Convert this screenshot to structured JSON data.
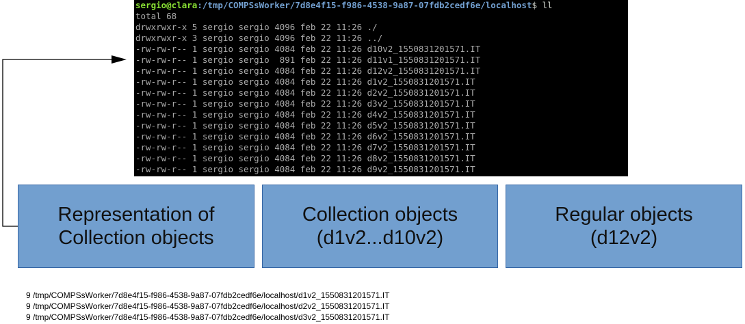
{
  "terminal": {
    "prompt": {
      "user_host": "sergio@clara",
      "path": ":/tmp/COMPSsWorker/7d8e4f15-f986-4538-9a87-07fdb2cedf6e/localhost",
      "command": "$ ll"
    },
    "lines": [
      "total 68",
      "drwxrwxr-x 5 sergio sergio 4096 feb 22 11:26 ./",
      "drwxrwxr-x 3 sergio sergio 4096 feb 22 11:26 ../",
      "-rw-rw-r-- 1 sergio sergio 4084 feb 22 11:26 d10v2_1550831201571.IT",
      "-rw-rw-r-- 1 sergio sergio  891 feb 22 11:26 d11v1_1550831201571.IT",
      "-rw-rw-r-- 1 sergio sergio 4084 feb 22 11:26 d12v2_1550831201571.IT",
      "-rw-rw-r-- 1 sergio sergio 4084 feb 22 11:26 d1v2_1550831201571.IT",
      "-rw-rw-r-- 1 sergio sergio 4084 feb 22 11:26 d2v2_1550831201571.IT",
      "-rw-rw-r-- 1 sergio sergio 4084 feb 22 11:26 d3v2_1550831201571.IT",
      "-rw-rw-r-- 1 sergio sergio 4084 feb 22 11:26 d4v2_1550831201571.IT",
      "-rw-rw-r-- 1 sergio sergio 4084 feb 22 11:26 d5v2_1550831201571.IT",
      "-rw-rw-r-- 1 sergio sergio 4084 feb 22 11:26 d6v2_1550831201571.IT",
      "-rw-rw-r-- 1 sergio sergio 4084 feb 22 11:26 d7v2_1550831201571.IT",
      "-rw-rw-r-- 1 sergio sergio 4084 feb 22 11:26 d8v2_1550831201571.IT",
      "-rw-rw-r-- 1 sergio sergio 4084 feb 22 11:26 d9v2_1550831201571.IT"
    ]
  },
  "boxes": [
    {
      "line1": "Representation of",
      "line2": "Collection objects"
    },
    {
      "line1": "Collection objects",
      "line2": "(d1v2...d10v2)"
    },
    {
      "line1": "Regular objects",
      "line2": "(d12v2)"
    }
  ],
  "file_contents": [
    "9 /tmp/COMPSsWorker/7d8e4f15-f986-4538-9a87-07fdb2cedf6e/localhost/d1v2_1550831201571.IT",
    "9 /tmp/COMPSsWorker/7d8e4f15-f986-4538-9a87-07fdb2cedf6e/localhost/d2v2_1550831201571.IT",
    "9 /tmp/COMPSsWorker/7d8e4f15-f986-4538-9a87-07fdb2cedf6e/localhost/d3v2_1550831201571.IT"
  ],
  "colors": {
    "terminal_bg": "#000000",
    "terminal_text": "#aaaaaa",
    "prompt_user": "#8ae234",
    "prompt_path": "#729fcf",
    "box_fill": "#729fcf",
    "box_border": "#3465a4"
  }
}
